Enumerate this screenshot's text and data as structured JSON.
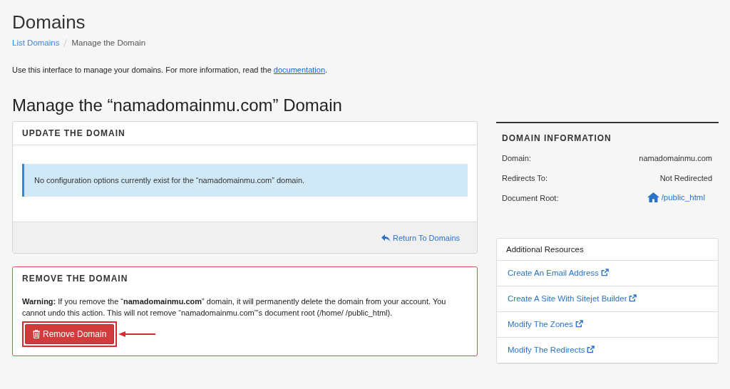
{
  "page_title": "Domains",
  "breadcrumb": [
    {
      "label": "List Domains",
      "kind": "link"
    },
    {
      "label": "Manage the Domain",
      "kind": "current"
    }
  ],
  "intro": {
    "text": "Use this interface to manage your domains. For more information, read the",
    "link": "documentation",
    "end": "."
  },
  "heading": "Manage the “namadomainmu.com” Domain",
  "update_panel": {
    "title": "UPDATE THE DOMAIN",
    "notice": "No configuration options currently exist for the “namadomainmu.com” domain.",
    "return_link": "Return To Domains"
  },
  "remove_panel": {
    "title": "REMOVE THE DOMAIN",
    "warning": "**Warning:** If you remove the “**namadomainmu.com**” domain, it will permanently delete the domain from your account. You cannot undo this action. This will not remove “namadomainmu.com”’s document root (/home/ /public_html).",
    "button": "Remove Domain",
    "highlighted": true
  },
  "domain_information": {
    "title": "DOMAIN INFORMATION",
    "rows": [
      {
        "label": "Domain:",
        "value": "namadomainmu.com",
        "kind": "text"
      },
      {
        "label": "Redirects To:",
        "value": "Not Redirected",
        "kind": "text"
      },
      {
        "label": "Document Root:",
        "value": "/public_html",
        "kind": "link"
      }
    ]
  },
  "additional_resources": {
    "title": "Additional Resources",
    "items": [
      "Create An Email Address",
      "Create A Site With Sitejet Builder",
      "Modify The Zones",
      "Modify The Redirects"
    ]
  }
}
